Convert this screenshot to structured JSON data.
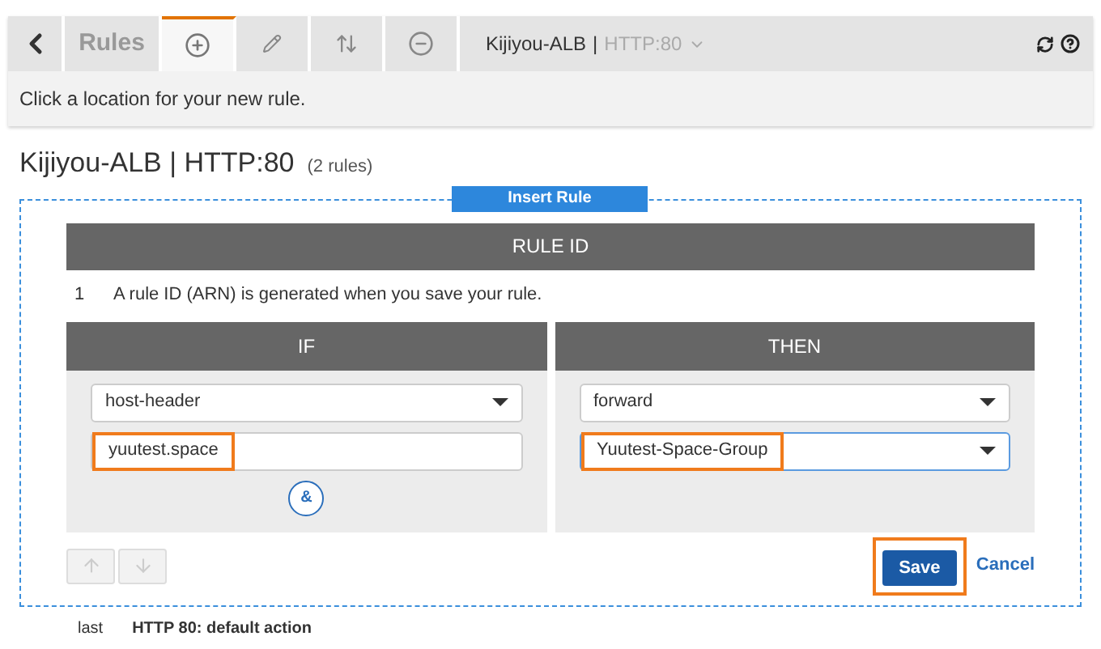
{
  "toolbar": {
    "tabs": [
      {
        "kind": "back",
        "selected": false
      },
      {
        "kind": "label",
        "label": "Rules",
        "selected": false
      },
      {
        "kind": "add",
        "selected": true
      },
      {
        "kind": "edit",
        "selected": false
      },
      {
        "kind": "reorder",
        "selected": false
      },
      {
        "kind": "remove",
        "selected": false
      }
    ],
    "balancer": "Kijiyou-ALB",
    "separator": "|",
    "listener": "HTTP:80"
  },
  "hint": "Click a location for your new rule.",
  "heading": {
    "title": "Kijiyou-ALB | HTTP:80",
    "count": "(2 rules)"
  },
  "insert_button": "Insert Rule",
  "rule_id": {
    "header": "RULE ID",
    "number": "1",
    "text": "A rule ID (ARN) is generated when you save your rule."
  },
  "condition": {
    "header": "IF",
    "type": "host-header",
    "value": "yuutest.space",
    "highlighted": true,
    "and_button": "&"
  },
  "action": {
    "header": "THEN",
    "type": "forward",
    "target": "Yuutest-Space-Group",
    "highlighted": true
  },
  "move_buttons": [
    {
      "kind": "up",
      "disabled": true
    },
    {
      "kind": "down",
      "disabled": true
    }
  ],
  "save_button": {
    "label": "Save",
    "highlighted": true
  },
  "cancel_link": "Cancel",
  "next_rule": {
    "number": "last",
    "text": "HTTP 80: default action"
  }
}
